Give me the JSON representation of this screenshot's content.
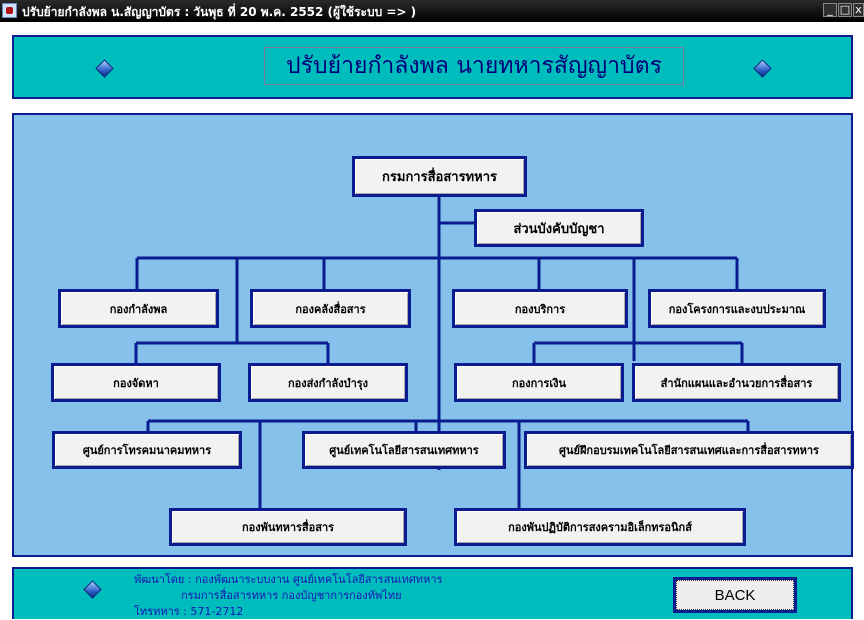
{
  "window": {
    "title": "ปรับย้ายกำลังพล น.สัญญาบัตร : วันพุธ    ที่ 20 พ.ค.  2552   (ผู้ใช้ระบบ => )",
    "controls": {
      "minimize": "_",
      "maximize": "□",
      "close": "x"
    }
  },
  "header": {
    "title": "ปรับย้ายกำลังพล นายทหารสัญญาบัตร"
  },
  "org": {
    "root": "กรมการสื่อสารทหาร",
    "staff": "ส่วนบังคับบัญชา",
    "units": {
      "personnel": "กองกำลังพล",
      "signal_depot": "กองคลังสื่อสาร",
      "services": "กองบริการ",
      "projects_budget": "กองโครงการและงบประมาณ",
      "procurement": "กองจัดหา",
      "supply_maintenance": "กองส่งกำลังบำรุง",
      "finance": "กองการเงิน",
      "planning_office": "สำนักแผนและอำนวยการสื่อสาร",
      "telecom_center": "ศูนย์การโทรคมนาคมทหาร",
      "it_center": "ศูนย์เทคโนโลยีสารสนเทศทหาร",
      "training_center": "ศูนย์ฝึกอบรมเทคโนโลยีสารสนเทศและการสื่อสารทหาร",
      "signal_battalion": "กองพันทหารสื่อสาร",
      "ew_battalion": "กองพันปฏิบัติการสงครามอิเล็กทรอนิกส์"
    }
  },
  "footer": {
    "developer": "พัฒนาโดย : กองพัฒนาระบบงาน ศูนย์เทคโนโลยีสารสนเทศทหาร",
    "department": "กรมการสื่อสารทหาร กองบัญชาการกองทัพไทย",
    "phone": "โทรทหาร : 571-2712",
    "back_label": "BACK"
  }
}
